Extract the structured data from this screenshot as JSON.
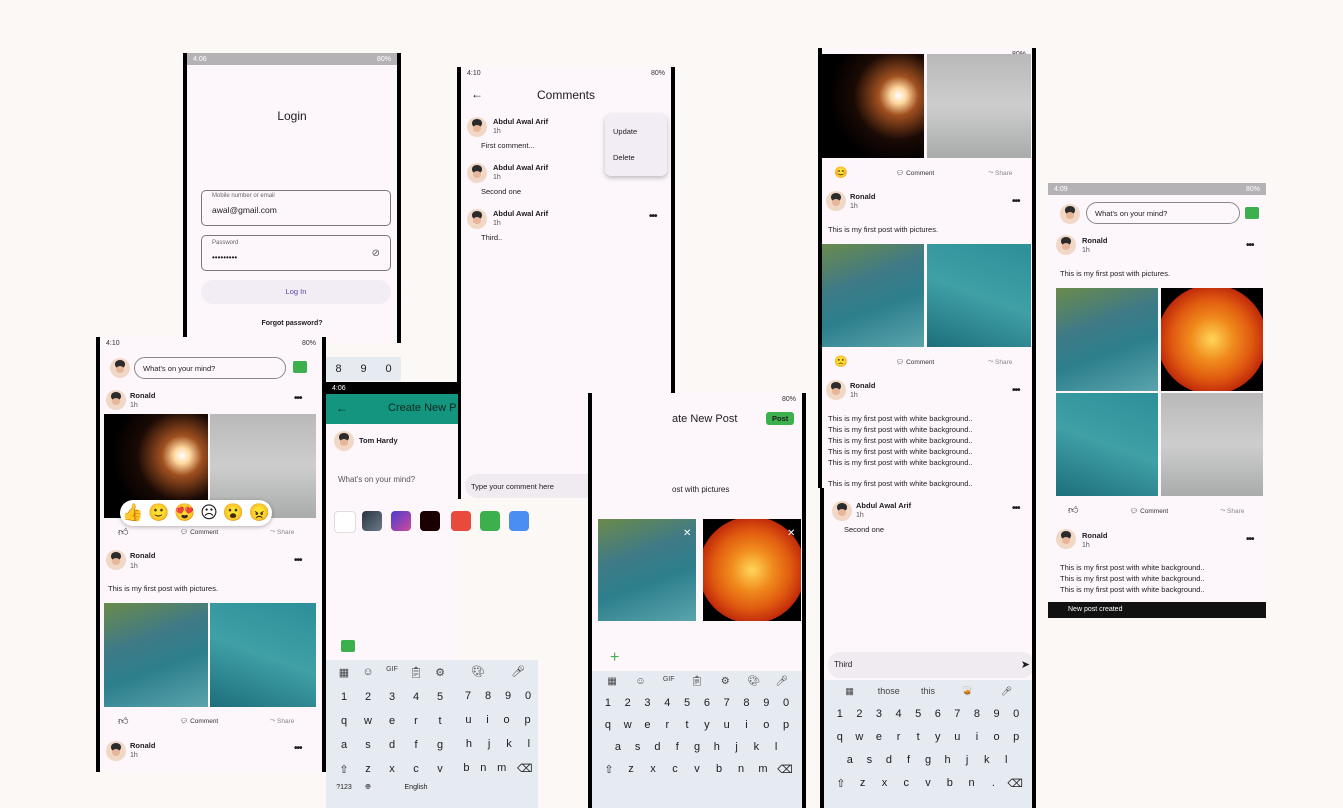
{
  "login": {
    "time": "4:06",
    "battery": "80%",
    "title": "Login",
    "email_label": "Mobile number or email",
    "email_value": "awal@gmail.com",
    "password_label": "Password",
    "password_value": "•••••••••",
    "login_button": "Log In",
    "forgot": "Forgot password?"
  },
  "comments": {
    "time": "4:10",
    "battery": "80%",
    "title": "Comments",
    "items": [
      {
        "name": "Abdul Awal Arif",
        "time": "1h",
        "text": "First comment..."
      },
      {
        "name": "Abdul Awal Arif",
        "time": "1h",
        "text": "Second one"
      },
      {
        "name": "Abdul Awal Arif",
        "time": "1h",
        "text": "Third.."
      }
    ],
    "menu": [
      "Update",
      "Delete"
    ],
    "input_placeholder": "Type your comment here"
  },
  "feed_left": {
    "time": "4:10",
    "battery": "80%",
    "whats_on_mind": "What's on your mind?",
    "post1_name": "Ronald",
    "post1_time": "1h",
    "comment_label": "Comment",
    "share_label": "Share",
    "post2_name": "Ronald",
    "post2_time": "1h",
    "post2_text": "This is my first post with pictures.",
    "post3_name": "Ronald",
    "post3_time": "1h",
    "numrow": [
      "8",
      "9",
      "0"
    ]
  },
  "create_left": {
    "time": "4:06",
    "title": "Create New P",
    "user": "Tom Hardy",
    "placeholder": "What's on your mind?",
    "swatches": [
      "#ffffff",
      "#2b3440",
      "#4a3bd0",
      "#1a0000",
      "#e84a3c",
      "#3bb04d",
      "#4b8ef1"
    ],
    "kbd_top": [
      "GIF"
    ],
    "row1": [
      "1",
      "2",
      "3",
      "4",
      "5",
      "6",
      "7",
      "8",
      "9",
      "0"
    ],
    "row2": [
      "q",
      "w",
      "e",
      "r",
      "t",
      "y",
      "u",
      "i",
      "o",
      "p"
    ],
    "row3": [
      "a",
      "s",
      "d",
      "f",
      "g",
      "h",
      "j",
      "k",
      "l"
    ],
    "row4": [
      "z",
      "x",
      "c",
      "v",
      "b",
      "n",
      "m"
    ],
    "row5_left": "?123",
    "row5_space": "English"
  },
  "create_right": {
    "battery": "80%",
    "title": "ate New Post",
    "post_button": "Post",
    "text": "ost with pictures",
    "kbd_top": [
      "GIF"
    ],
    "row1": [
      "1",
      "2",
      "3",
      "4",
      "5",
      "6",
      "7",
      "8",
      "9",
      "0"
    ],
    "row2": [
      "q",
      "w",
      "e",
      "r",
      "t",
      "y",
      "u",
      "i",
      "o",
      "p"
    ],
    "row3": [
      "a",
      "s",
      "d",
      "f",
      "g",
      "h",
      "j",
      "k",
      "l"
    ],
    "row4": [
      "z",
      "x",
      "c",
      "v",
      "b",
      "n",
      "m"
    ]
  },
  "feed_mid": {
    "battery": "80%",
    "comment_label": "Comment",
    "share_label": "Share",
    "post_name": "Ronald",
    "post_time": "1h",
    "post_text": "This is my first post with pictures.",
    "post2_name": "Ronald",
    "post2_time": "1h",
    "white_lines": [
      "This is my first post with white background..",
      "This is my first post with white background..",
      "This is my first post with white background..",
      "This is my first post with white background..",
      "This is my first post with white background..",
      "This is my first post with white background.."
    ]
  },
  "comment_edit": {
    "name": "Abdul Awal Arif",
    "time": "1h",
    "text": "Second one",
    "input": "Third",
    "suggestions": [
      "those",
      "this"
    ],
    "row1": [
      "1",
      "2",
      "3",
      "4",
      "5",
      "6",
      "7",
      "8",
      "9",
      "0"
    ],
    "row2": [
      "q",
      "w",
      "e",
      "r",
      "t",
      "y",
      "u",
      "i",
      "o",
      "p"
    ],
    "row3": [
      "a",
      "s",
      "d",
      "f",
      "g",
      "h",
      "j",
      "k",
      "l"
    ],
    "row4": [
      "z",
      "x",
      "c",
      "v",
      "b",
      "n",
      "."
    ]
  },
  "feed_right": {
    "time": "4:09",
    "battery": "80%",
    "whats_on_mind": "What's on your mind?",
    "post_name": "Ronald",
    "post_time": "1h",
    "post_text": "This is my first post with pictures.",
    "comment_label": "Comment",
    "share_label": "Share",
    "post2_name": "Ronald",
    "post2_time": "1h",
    "white_lines": [
      "This is my first post with white background..",
      "This is my first post with white background..",
      "This is my first post with white background.."
    ],
    "snackbar": "New post created"
  }
}
